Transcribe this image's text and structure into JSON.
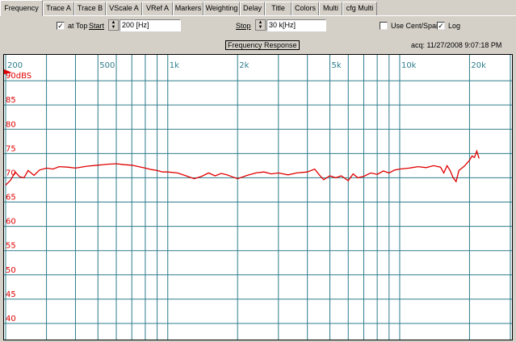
{
  "tabs": [
    {
      "label": "Frequency",
      "active": true
    },
    {
      "label": "Trace A"
    },
    {
      "label": "Trace B"
    },
    {
      "label": "VScale A"
    },
    {
      "label": "VRef A"
    },
    {
      "label": "Markers"
    },
    {
      "label": "Weighting"
    },
    {
      "label": "Delay"
    },
    {
      "label": "Title"
    },
    {
      "label": "Colors"
    },
    {
      "label": "Multi"
    },
    {
      "label": "cfg Multi"
    }
  ],
  "controls": {
    "at_top_label": "at Top",
    "at_top_checked": true,
    "start_label": "Start",
    "start_value": "200 [Hz]",
    "stop_label": "Stop",
    "stop_value": "30 k[Hz]",
    "cent_span_label": "Use Cent/Span",
    "cent_span_checked": false,
    "log_label": "Log",
    "log_checked": true
  },
  "graph": {
    "title": "Frequency Response",
    "acq": "acq: 11/27/2008 9:07:18 PM"
  },
  "chart_data": {
    "type": "line",
    "x_scale": "log",
    "xlim": [
      200,
      30000
    ],
    "ylim": [
      37,
      95
    ],
    "x_tick_labels": [
      {
        "x": 200,
        "label": "200"
      },
      {
        "x": 500,
        "label": "500"
      },
      {
        "x": 1000,
        "label": "1k"
      },
      {
        "x": 2000,
        "label": "2k"
      },
      {
        "x": 5000,
        "label": "5k"
      },
      {
        "x": 10000,
        "label": "10k"
      },
      {
        "x": 20000,
        "label": "20k"
      }
    ],
    "y_tick_labels": [
      {
        "y": 90,
        "label": "90dBS"
      },
      {
        "y": 85,
        "label": "85"
      },
      {
        "y": 80,
        "label": "80"
      },
      {
        "y": 75,
        "label": "75"
      },
      {
        "y": 70,
        "label": "70"
      },
      {
        "y": 65,
        "label": "65"
      },
      {
        "y": 60,
        "label": "60"
      },
      {
        "y": 55,
        "label": "55"
      },
      {
        "y": 50,
        "label": "50"
      },
      {
        "y": 45,
        "label": "45"
      },
      {
        "y": 40,
        "label": "40"
      }
    ],
    "grid": true,
    "colors": {
      "line": "#e00000",
      "grid": "#2e7d8c",
      "y_labels": "#e00000",
      "x_labels": "#2e7d8c"
    },
    "series": [
      {
        "x": [
          200,
          210,
          220,
          230,
          240,
          250,
          265,
          280,
          300,
          320,
          340,
          370,
          400,
          450,
          500,
          550,
          600,
          650,
          700,
          750,
          800,
          850,
          900,
          950,
          1000,
          1100,
          1200,
          1300,
          1400,
          1500,
          1600,
          1700,
          1800,
          1900,
          2000,
          2200,
          2400,
          2600,
          2800,
          3000,
          3300,
          3600,
          4000,
          4300,
          4500,
          4700,
          5000,
          5300,
          5600,
          6000,
          6300,
          6600,
          7000,
          7500,
          8000,
          8500,
          9000,
          9500,
          10000,
          11000,
          12000,
          13000,
          14000,
          15000,
          15500,
          16000,
          16500,
          17000,
          17500,
          18000,
          19000,
          20000,
          20500,
          21000,
          21500,
          22000
        ],
        "y": [
          68.5,
          69.5,
          71.2,
          70.2,
          70.0,
          71.5,
          70.5,
          71.6,
          72.0,
          71.8,
          72.3,
          72.2,
          72.0,
          72.4,
          72.6,
          72.8,
          72.9,
          72.7,
          72.6,
          72.3,
          72.0,
          71.7,
          71.5,
          71.2,
          71.2,
          71.0,
          70.4,
          69.8,
          70.3,
          71.0,
          70.4,
          70.9,
          70.6,
          70.2,
          69.8,
          70.5,
          71.0,
          71.2,
          70.8,
          71.0,
          70.6,
          71.0,
          71.2,
          71.8,
          70.6,
          69.6,
          70.4,
          70.0,
          70.4,
          69.4,
          70.8,
          70.0,
          70.3,
          71.0,
          70.7,
          71.4,
          71.0,
          71.6,
          71.8,
          72.0,
          72.3,
          72.1,
          72.5,
          72.2,
          71.0,
          72.5,
          71.5,
          70.0,
          69.2,
          71.5,
          72.4,
          73.6,
          74.5,
          74.2,
          75.5,
          74.0
        ]
      }
    ]
  }
}
